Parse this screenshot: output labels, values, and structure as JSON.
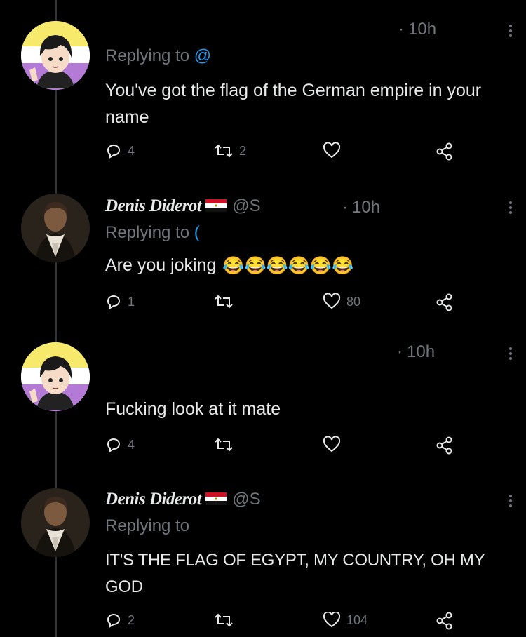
{
  "tweets": [
    {
      "display_name": "",
      "handle": "",
      "time": "10h",
      "replying_prefix": "Replying to",
      "replying_handle": "@",
      "text": "You've got the flag of the German empire in your name",
      "replies": "4",
      "retweets": "2",
      "likes": "",
      "avatar": "anime-boy-avatar"
    },
    {
      "display_name": "Denis Diderot",
      "handle": "@S",
      "time": "10h",
      "replying_prefix": "Replying to",
      "replying_handle": "(",
      "text": "Are you joking",
      "emoji": "😂😂😂😂😂😂",
      "replies": "1",
      "retweets": "",
      "likes": "80",
      "avatar": "portrait-avatar"
    },
    {
      "display_name": "",
      "handle": "",
      "time": "10h",
      "text": "Fucking look at it mate",
      "replies": "4",
      "retweets": "",
      "likes": "",
      "avatar": "anime-boy-avatar"
    },
    {
      "display_name": "Denis Diderot",
      "handle": "@S",
      "time": "",
      "replying_prefix": "Replying to",
      "replying_handle": "",
      "text": "IT'S THE FLAG OF EGYPT, MY COUNTRY, OH MY GOD",
      "replies": "2",
      "retweets": "",
      "likes": "104",
      "avatar": "portrait-avatar"
    }
  ],
  "colors": {
    "background": "#000000",
    "text": "#e7e9ea",
    "muted": "#71767b",
    "link": "#1d9bf0",
    "thread_line": "#2f3336"
  }
}
